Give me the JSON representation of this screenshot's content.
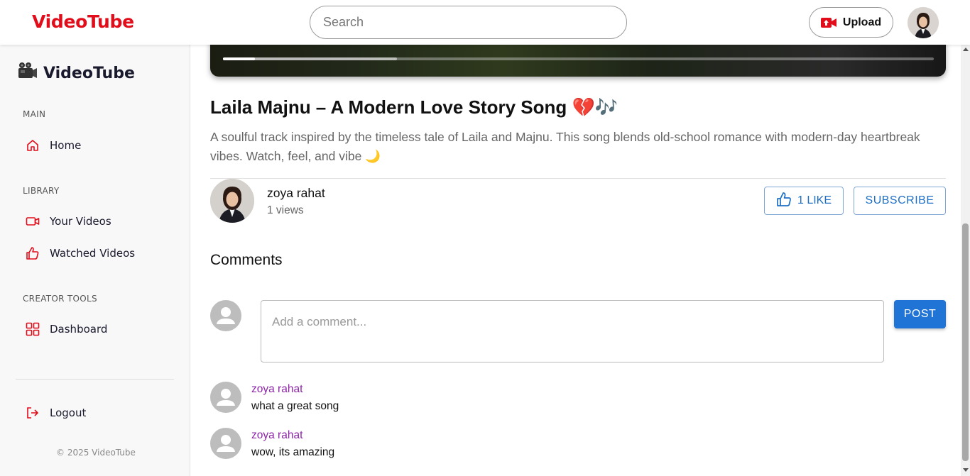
{
  "header": {
    "brand": "VideoTube",
    "search_placeholder": "Search",
    "upload_label": "Upload",
    "avatar_icon": "user-avatar-icon"
  },
  "sidebar": {
    "brand": "VideoTube",
    "brand_icon": "video-camera-icon",
    "sections": [
      {
        "title": "MAIN",
        "items": [
          {
            "label": "Home",
            "icon": "home-icon"
          }
        ]
      },
      {
        "title": "LIBRARY",
        "items": [
          {
            "label": "Your Videos",
            "icon": "video-icon"
          },
          {
            "label": "Watched Videos",
            "icon": "thumbs-up-icon"
          }
        ]
      },
      {
        "title": "CREATOR TOOLS",
        "items": [
          {
            "label": "Dashboard",
            "icon": "dashboard-icon"
          }
        ]
      }
    ],
    "logout_label": "Logout",
    "footer": "© 2025 VideoTube",
    "accent_color": "#e10d1a"
  },
  "video": {
    "played_fraction": 0.045,
    "buffered_fraction": 0.245,
    "title": "Laila Majnu – A Modern Love Story Song 💔🎶",
    "description": "A soulful track inspired by the timeless tale of Laila and Majnu. This song blends old-school romance with modern-day heartbreak vibes. Watch, feel, and vibe 🌙",
    "channel_name": "zoya rahat",
    "views": "1 views",
    "like_label": "1 LIKE",
    "subscribe_label": "SUBSCRIBE"
  },
  "comments": {
    "heading": "Comments",
    "input_placeholder": "Add a comment...",
    "post_label": "POST",
    "items": [
      {
        "author": "zoya rahat",
        "text": "what a great song"
      },
      {
        "author": "zoya rahat",
        "text": "wow, its amazing"
      }
    ],
    "author_color": "#8e24aa",
    "button_color": "#1f74d6"
  }
}
